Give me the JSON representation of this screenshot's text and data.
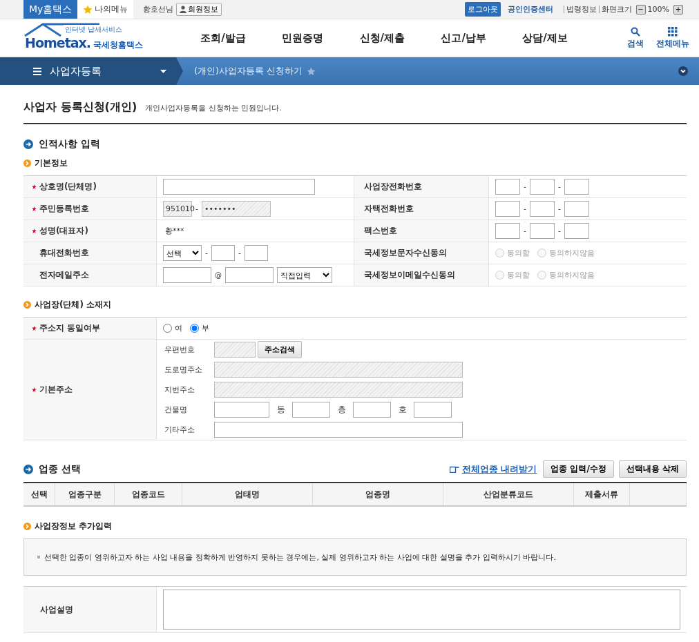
{
  "top_bar": {
    "my_hometax": "My홈택스",
    "my_menu": "나의메뉴",
    "user": "황호선님",
    "member_info": "회원정보",
    "logout": "로그아웃",
    "cert_center": "공인인증센터",
    "legal": "법령정보",
    "screen_size": "화면크기",
    "zoom_out": "−",
    "zoom": "100%",
    "zoom_in": "+"
  },
  "header": {
    "logo_tagline": "인터넷 납세서비스",
    "logo_text": "Hometax.",
    "logo_name": "국세청홈택스",
    "menu": [
      "조회/발급",
      "민원증명",
      "신청/제출",
      "신고/납부",
      "상담/제보"
    ],
    "search": "검색",
    "all_menu": "전체메뉴"
  },
  "nav": {
    "section": "사업자등록",
    "page": "(개인)사업자등록 신청하기"
  },
  "page": {
    "title": "사업자 등록신청(개인)",
    "description": "개인사업자등록을 신청하는 민원입니다."
  },
  "personal": {
    "title": "인적사항 입력",
    "subtitle": "기본정보",
    "rows": [
      {
        "left": {
          "label": "상호명(단체명)",
          "required": true,
          "kind": "text"
        },
        "right": {
          "label": "사업장전화번호",
          "required": false,
          "kind": "phone",
          "separator": "-"
        }
      },
      {
        "left": {
          "label": "주민등록번호",
          "required": true,
          "kind": "rrn",
          "front": "951010",
          "separator": "-",
          "back": "•••••••"
        },
        "right": {
          "label": "자택전화번호",
          "required": false,
          "kind": "phone",
          "separator": "-"
        }
      },
      {
        "left": {
          "label": "성명(대표자)",
          "required": true,
          "kind": "static",
          "value": "황***"
        },
        "right": {
          "label": "팩스번호",
          "required": false,
          "kind": "phone",
          "separator": "-"
        }
      },
      {
        "left": {
          "label": "휴대전화번호",
          "required": false,
          "kind": "mobile",
          "select": "선택",
          "separator": "-"
        },
        "right": {
          "label": "국세정보문자수신동의",
          "required": false,
          "kind": "radio",
          "disabled": true,
          "options": [
            {
              "label": "동의함",
              "selected": false
            },
            {
              "label": "동의하지않음",
              "selected": false
            }
          ]
        }
      },
      {
        "left": {
          "label": "전자메일주소",
          "required": false,
          "kind": "email",
          "at": "@",
          "select": "직접입력"
        },
        "right": {
          "label": "국세정보이메일수신동의",
          "required": false,
          "kind": "radio",
          "disabled": true,
          "options": [
            {
              "label": "동의함",
              "selected": false
            },
            {
              "label": "동의하지않음",
              "selected": false
            }
          ]
        }
      }
    ]
  },
  "location": {
    "subtitle": "사업장(단체) 소재지",
    "same_address": {
      "label": "주소지 동일여부",
      "required": true,
      "options": [
        {
          "label": "여",
          "selected": false
        },
        {
          "label": "부",
          "selected": true
        }
      ]
    },
    "address": {
      "label": "기본주소",
      "required": true,
      "postcode": "우편번호",
      "search_button": "주소검색",
      "road": "도로명주소",
      "lot": "지번주소",
      "building": "건물명",
      "dong": "동",
      "floor": "층",
      "ho": "호",
      "other": "기타주소"
    }
  },
  "business_type": {
    "title": "업종 선택",
    "download_link": "전체업종 내려받기",
    "buttons": [
      "업종 입력/수정",
      "선택내용 삭제"
    ],
    "columns": [
      "선택",
      "업종구분",
      "업종코드",
      "업태명",
      "업종명",
      "산업분류코드",
      "제출서류"
    ]
  },
  "extra": {
    "subtitle": "사업장정보 추가입력",
    "notice": "선택한 업종이 영위하고자 하는 사업 내용을 정확하게 반영하지 못하는 경우에는, 실제 영위하고자 하는 사업에 대한 설명을 추가 입력하시기 바랍니다.",
    "description_label": "사업설명"
  }
}
